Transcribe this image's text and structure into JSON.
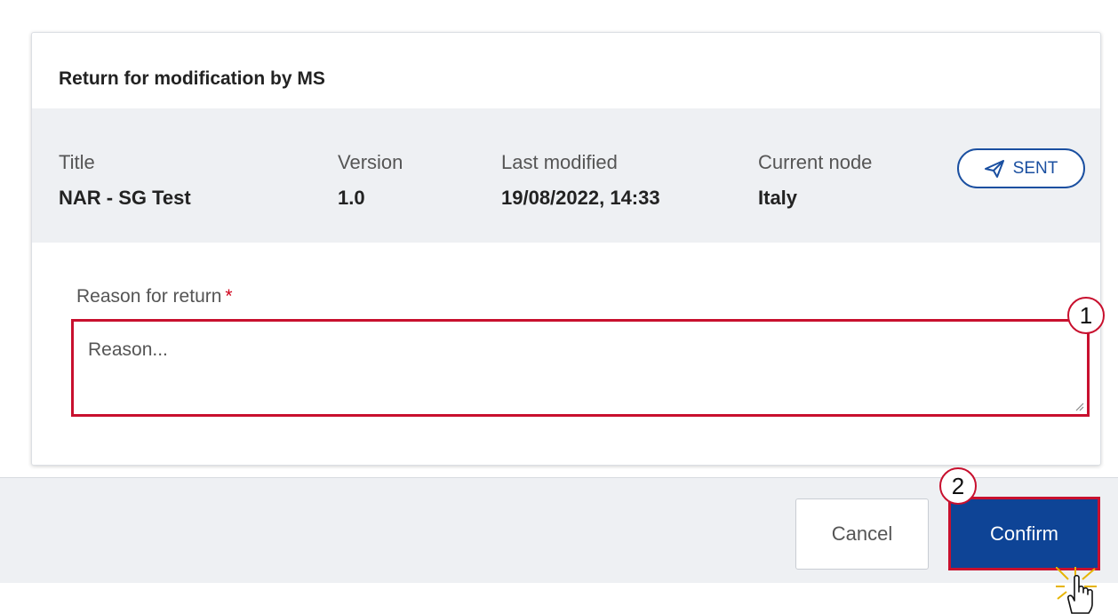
{
  "dialog": {
    "title": "Return for modification by MS",
    "meta": [
      {
        "label": "Title",
        "value": "NAR - SG Test"
      },
      {
        "label": "Version",
        "value": "1.0"
      },
      {
        "label": "Last modified",
        "value": "19/08/2022, 14:33"
      },
      {
        "label": "Current node",
        "value": "Italy"
      }
    ],
    "status": {
      "label": "SENT",
      "icon": "paper-plane-icon",
      "color": "#1a4fa0"
    },
    "reason": {
      "label": "Reason for return",
      "required_mark": "*",
      "placeholder": "Reason...",
      "value": ""
    }
  },
  "footer": {
    "cancel_label": "Cancel",
    "confirm_label": "Confirm"
  },
  "callouts": {
    "step1": "1",
    "step2": "2"
  },
  "colors": {
    "accent": "#0e4496",
    "highlight": "#c8102e"
  }
}
